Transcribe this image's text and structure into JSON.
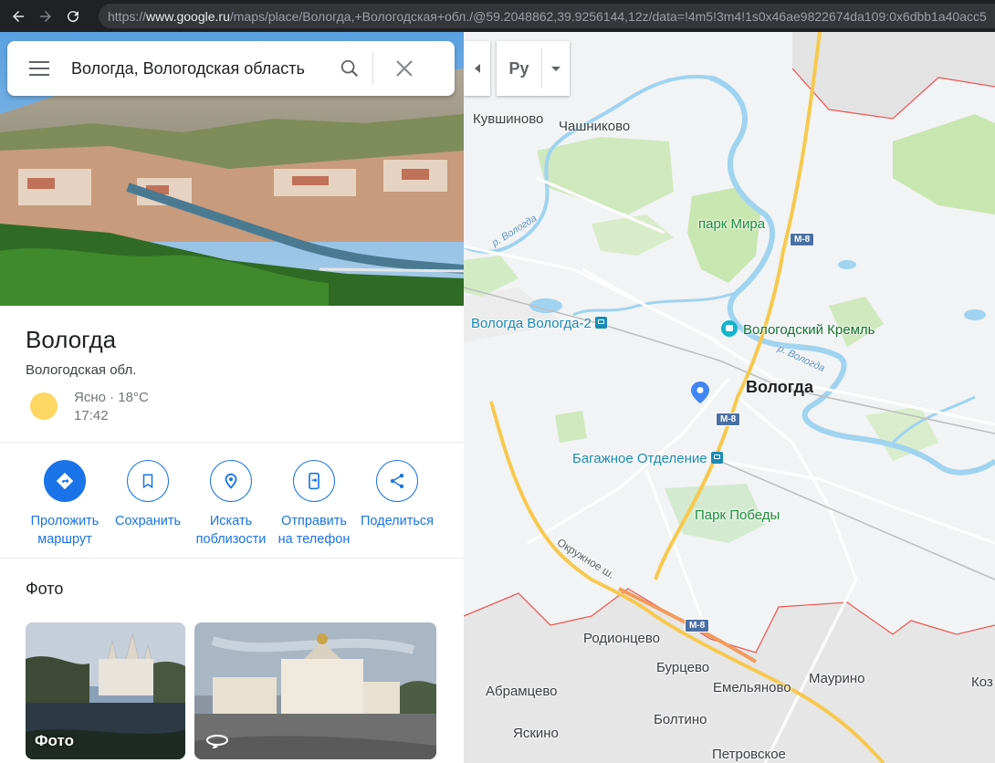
{
  "browser": {
    "url_prefix": "https://",
    "url_host": "www.google.ru",
    "url_path": "/maps/place/Вологда,+Вологодская+обл./@59.2048862,39.9256144,12z/data=!4m5!3m4!1s0x46ae9822674da109:0x6dbb1a40acc5"
  },
  "search": {
    "value": "Вологда, Вологодская область"
  },
  "place": {
    "title": "Вологда",
    "subtitle": "Вологодская обл.",
    "weather": "Ясно · 18°C",
    "time": "17:42"
  },
  "actions": [
    {
      "label1": "Проложить",
      "label2": "маршрут"
    },
    {
      "label1": "Сохранить",
      "label2": ""
    },
    {
      "label1": "Искать",
      "label2": "поблизости"
    },
    {
      "label1": "Отправить",
      "label2": "на телефон"
    },
    {
      "label1": "Поделиться",
      "label2": ""
    }
  ],
  "photos": {
    "title": "Фото",
    "first_caption": "Фото"
  },
  "map_controls": {
    "language": "Ру"
  },
  "map_labels": {
    "kuvshinovo": "Кувшиново",
    "chashnikovo": "Чашниково",
    "park_mira": "парк Мира",
    "river_vologda_1": "р. Вологда",
    "river_vologda_2": "р. Вологда",
    "station": "Вологда Вологда-2",
    "kremlin": "Вологодский Кремль",
    "city": "Вологда",
    "baggage": "Багажное Отделение",
    "park_pobedy": "Парк Победы",
    "ring_road": "Окружное ш.",
    "rodiontsevo": "Родионцево",
    "burtsevo": "Бурцево",
    "abramtsevo": "Абрамцево",
    "emelyanovo": "Емельяново",
    "maurino": "Маурино",
    "yaskino": "Яскино",
    "boltino": "Болтино",
    "petrovskoe": "Петровское",
    "koz": "Коз",
    "m8_1": "М-8",
    "m8_2": "М-8",
    "m8_3": "М-8"
  },
  "colors": {
    "accent": "#1a73e8",
    "water": "#9fd3f0",
    "park": "#c8e6b0",
    "boundary": "#e85d5d",
    "highway": "#f6c94e"
  }
}
